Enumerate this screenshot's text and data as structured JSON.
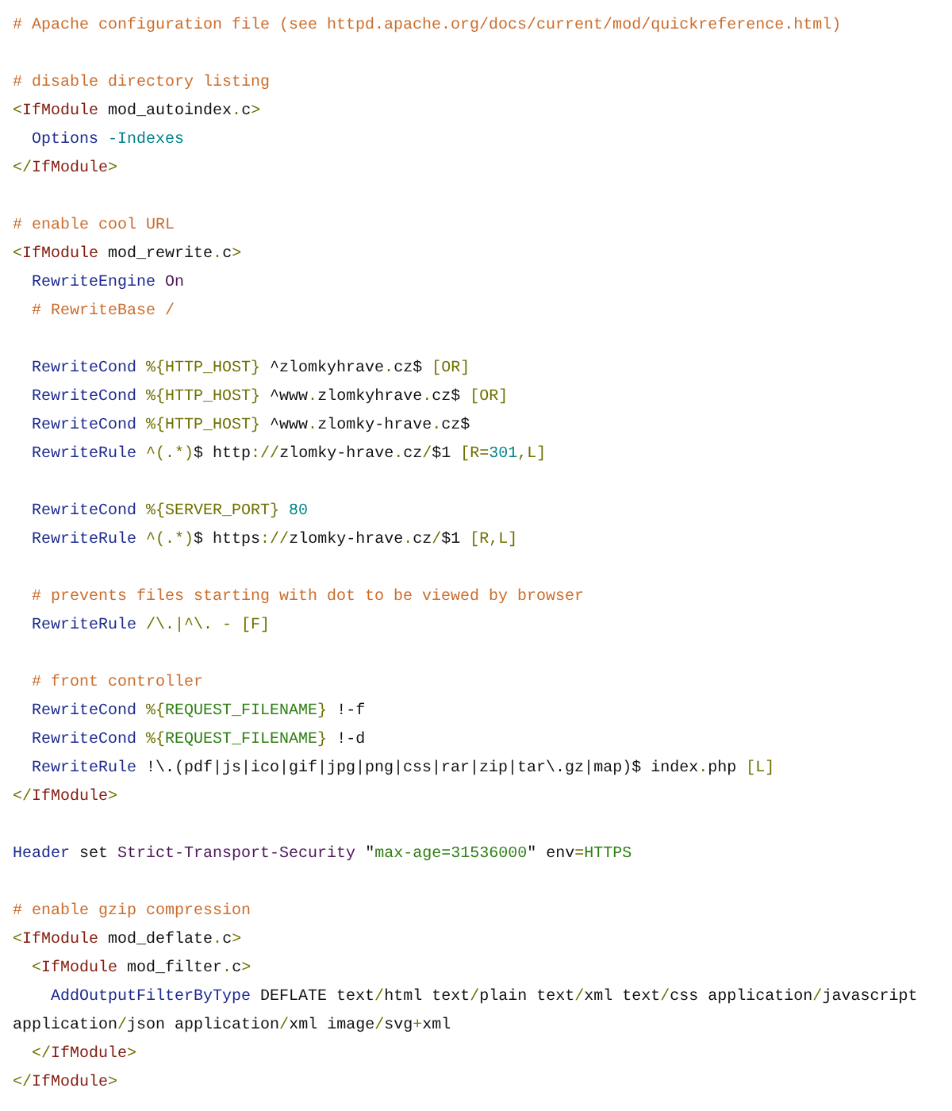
{
  "code_lines": [
    {
      "kind": "code",
      "tokens": [
        {
          "text": "# Apache configuration file (see httpd.apache.org/docs/current/mod/quickreference.html)",
          "kind": "comment"
        }
      ]
    },
    {
      "kind": "blank"
    },
    {
      "kind": "code",
      "tokens": [
        {
          "text": "# disable directory listing",
          "kind": "comment"
        }
      ]
    },
    {
      "kind": "code",
      "tokens": [
        {
          "text": "<",
          "kind": "punct"
        },
        {
          "text": "IfModule",
          "kind": "tag"
        },
        {
          "text": " mod_autoindex",
          "kind": "plain"
        },
        {
          "text": ".",
          "kind": "punct"
        },
        {
          "text": "c",
          "kind": "plain"
        },
        {
          "text": ">",
          "kind": "punct"
        }
      ]
    },
    {
      "kind": "code",
      "tokens": [
        {
          "text": "  Options",
          "kind": "directive"
        },
        {
          "text": " -Indexes",
          "kind": "number"
        }
      ]
    },
    {
      "kind": "code",
      "tokens": [
        {
          "text": "</",
          "kind": "punct"
        },
        {
          "text": "IfModule",
          "kind": "tag"
        },
        {
          "text": ">",
          "kind": "punct"
        }
      ]
    },
    {
      "kind": "blank"
    },
    {
      "kind": "code",
      "tokens": [
        {
          "text": "# enable cool URL",
          "kind": "comment"
        }
      ]
    },
    {
      "kind": "code",
      "tokens": [
        {
          "text": "<",
          "kind": "punct"
        },
        {
          "text": "IfModule",
          "kind": "tag"
        },
        {
          "text": " mod_rewrite",
          "kind": "plain"
        },
        {
          "text": ".",
          "kind": "punct"
        },
        {
          "text": "c",
          "kind": "plain"
        },
        {
          "text": ">",
          "kind": "punct"
        }
      ]
    },
    {
      "kind": "code",
      "tokens": [
        {
          "text": "  RewriteEngine",
          "kind": "directive"
        },
        {
          "text": " On",
          "kind": "keyword"
        }
      ]
    },
    {
      "kind": "code",
      "tokens": [
        {
          "text": "  # RewriteBase /",
          "kind": "comment"
        }
      ]
    },
    {
      "kind": "blank"
    },
    {
      "kind": "code",
      "tokens": [
        {
          "text": "  RewriteCond",
          "kind": "directive"
        },
        {
          "text": " %{HTTP_HOST}",
          "kind": "punct"
        },
        {
          "text": " ^zlomkyhrave",
          "kind": "plain"
        },
        {
          "text": ".",
          "kind": "punct"
        },
        {
          "text": "cz$ ",
          "kind": "plain"
        },
        {
          "text": "[OR]",
          "kind": "punct"
        }
      ]
    },
    {
      "kind": "code",
      "tokens": [
        {
          "text": "  RewriteCond",
          "kind": "directive"
        },
        {
          "text": " %{HTTP_HOST}",
          "kind": "punct"
        },
        {
          "text": " ^www",
          "kind": "plain"
        },
        {
          "text": ".",
          "kind": "punct"
        },
        {
          "text": "zlomkyhrave",
          "kind": "plain"
        },
        {
          "text": ".",
          "kind": "punct"
        },
        {
          "text": "cz$ ",
          "kind": "plain"
        },
        {
          "text": "[OR]",
          "kind": "punct"
        }
      ]
    },
    {
      "kind": "code",
      "tokens": [
        {
          "text": "  RewriteCond",
          "kind": "directive"
        },
        {
          "text": " %{HTTP_HOST}",
          "kind": "punct"
        },
        {
          "text": " ^www",
          "kind": "plain"
        },
        {
          "text": ".",
          "kind": "punct"
        },
        {
          "text": "zlomky-hrave",
          "kind": "plain"
        },
        {
          "text": ".",
          "kind": "punct"
        },
        {
          "text": "cz$",
          "kind": "plain"
        }
      ]
    },
    {
      "kind": "code",
      "tokens": [
        {
          "text": "  RewriteRule",
          "kind": "directive"
        },
        {
          "text": " ^(.*)",
          "kind": "punct"
        },
        {
          "text": "$ http",
          "kind": "plain"
        },
        {
          "text": "://",
          "kind": "punct"
        },
        {
          "text": "zlomky-hrave",
          "kind": "plain"
        },
        {
          "text": ".",
          "kind": "punct"
        },
        {
          "text": "cz",
          "kind": "plain"
        },
        {
          "text": "/",
          "kind": "punct"
        },
        {
          "text": "$1 ",
          "kind": "plain"
        },
        {
          "text": "[R=",
          "kind": "punct"
        },
        {
          "text": "301",
          "kind": "number"
        },
        {
          "text": ",L]",
          "kind": "punct"
        }
      ]
    },
    {
      "kind": "blank"
    },
    {
      "kind": "code",
      "tokens": [
        {
          "text": "  RewriteCond",
          "kind": "directive"
        },
        {
          "text": " %{SERVER_PORT}",
          "kind": "punct"
        },
        {
          "text": " 80",
          "kind": "number"
        }
      ]
    },
    {
      "kind": "code",
      "tokens": [
        {
          "text": "  RewriteRule",
          "kind": "directive"
        },
        {
          "text": " ^(.*)",
          "kind": "punct"
        },
        {
          "text": "$ https",
          "kind": "plain"
        },
        {
          "text": "://",
          "kind": "punct"
        },
        {
          "text": "zlomky-hrave",
          "kind": "plain"
        },
        {
          "text": ".",
          "kind": "punct"
        },
        {
          "text": "cz",
          "kind": "plain"
        },
        {
          "text": "/",
          "kind": "punct"
        },
        {
          "text": "$1 ",
          "kind": "plain"
        },
        {
          "text": "[R,L]",
          "kind": "punct"
        }
      ]
    },
    {
      "kind": "blank"
    },
    {
      "kind": "code",
      "tokens": [
        {
          "text": "  # prevents files starting with dot to be viewed by browser",
          "kind": "comment"
        }
      ]
    },
    {
      "kind": "code",
      "tokens": [
        {
          "text": "  RewriteRule",
          "kind": "directive"
        },
        {
          "text": " /\\.|^\\. - [F]",
          "kind": "punct"
        }
      ]
    },
    {
      "kind": "blank"
    },
    {
      "kind": "code",
      "tokens": [
        {
          "text": "  # front controller",
          "kind": "comment"
        }
      ]
    },
    {
      "kind": "code",
      "tokens": [
        {
          "text": "  RewriteCond",
          "kind": "directive"
        },
        {
          "text": " %{",
          "kind": "punct"
        },
        {
          "text": "REQUEST_FILENAME",
          "kind": "string"
        },
        {
          "text": "}",
          "kind": "punct"
        },
        {
          "text": " !-f",
          "kind": "plain"
        }
      ]
    },
    {
      "kind": "code",
      "tokens": [
        {
          "text": "  RewriteCond",
          "kind": "directive"
        },
        {
          "text": " %{",
          "kind": "punct"
        },
        {
          "text": "REQUEST_FILENAME",
          "kind": "string"
        },
        {
          "text": "}",
          "kind": "punct"
        },
        {
          "text": " !-d",
          "kind": "plain"
        }
      ]
    },
    {
      "kind": "code",
      "tokens": [
        {
          "text": "  RewriteRule",
          "kind": "directive"
        },
        {
          "text": " !\\.(pdf|js|ico|gif|jpg|png|css|rar|zip|tar\\.gz|map)$ index",
          "kind": "plain"
        },
        {
          "text": ".",
          "kind": "punct"
        },
        {
          "text": "php ",
          "kind": "plain"
        },
        {
          "text": "[L]",
          "kind": "punct"
        }
      ]
    },
    {
      "kind": "code",
      "tokens": [
        {
          "text": "</",
          "kind": "punct"
        },
        {
          "text": "IfModule",
          "kind": "tag"
        },
        {
          "text": ">",
          "kind": "punct"
        }
      ]
    },
    {
      "kind": "blank"
    },
    {
      "kind": "code",
      "tokens": [
        {
          "text": "Header",
          "kind": "directive"
        },
        {
          "text": " set ",
          "kind": "plain"
        },
        {
          "text": "Strict-Transport-Security",
          "kind": "keyword"
        },
        {
          "text": " \"",
          "kind": "plain"
        },
        {
          "text": "max-age=31536000",
          "kind": "string"
        },
        {
          "text": "\" env",
          "kind": "plain"
        },
        {
          "text": "=",
          "kind": "punct"
        },
        {
          "text": "HTTPS",
          "kind": "string"
        }
      ]
    },
    {
      "kind": "blank"
    },
    {
      "kind": "code",
      "tokens": [
        {
          "text": "# enable gzip compression",
          "kind": "comment"
        }
      ]
    },
    {
      "kind": "code",
      "tokens": [
        {
          "text": "<",
          "kind": "punct"
        },
        {
          "text": "IfModule",
          "kind": "tag"
        },
        {
          "text": " mod_deflate",
          "kind": "plain"
        },
        {
          "text": ".",
          "kind": "punct"
        },
        {
          "text": "c",
          "kind": "plain"
        },
        {
          "text": ">",
          "kind": "punct"
        }
      ]
    },
    {
      "kind": "code",
      "tokens": [
        {
          "text": "  <",
          "kind": "punct"
        },
        {
          "text": "IfModule",
          "kind": "tag"
        },
        {
          "text": " mod_filter",
          "kind": "plain"
        },
        {
          "text": ".",
          "kind": "punct"
        },
        {
          "text": "c",
          "kind": "plain"
        },
        {
          "text": ">",
          "kind": "punct"
        }
      ]
    },
    {
      "kind": "code",
      "tokens": [
        {
          "text": "    AddOutputFilterByType",
          "kind": "directive"
        },
        {
          "text": " DEFLATE text",
          "kind": "plain"
        },
        {
          "text": "/",
          "kind": "punct"
        },
        {
          "text": "html text",
          "kind": "plain"
        },
        {
          "text": "/",
          "kind": "punct"
        },
        {
          "text": "plain text",
          "kind": "plain"
        },
        {
          "text": "/",
          "kind": "punct"
        },
        {
          "text": "xml text",
          "kind": "plain"
        },
        {
          "text": "/",
          "kind": "punct"
        },
        {
          "text": "css application",
          "kind": "plain"
        },
        {
          "text": "/",
          "kind": "punct"
        },
        {
          "text": "javascript",
          "kind": "plain"
        }
      ]
    },
    {
      "kind": "code",
      "tokens": [
        {
          "text": "application",
          "kind": "plain"
        },
        {
          "text": "/",
          "kind": "punct"
        },
        {
          "text": "json application",
          "kind": "plain"
        },
        {
          "text": "/",
          "kind": "punct"
        },
        {
          "text": "xml image",
          "kind": "plain"
        },
        {
          "text": "/",
          "kind": "punct"
        },
        {
          "text": "svg",
          "kind": "plain"
        },
        {
          "text": "+",
          "kind": "punct"
        },
        {
          "text": "xml",
          "kind": "plain"
        }
      ]
    },
    {
      "kind": "code",
      "tokens": [
        {
          "text": "  </",
          "kind": "punct"
        },
        {
          "text": "IfModule",
          "kind": "tag"
        },
        {
          "text": ">",
          "kind": "punct"
        }
      ]
    },
    {
      "kind": "code",
      "tokens": [
        {
          "text": "</",
          "kind": "punct"
        },
        {
          "text": "IfModule",
          "kind": "tag"
        },
        {
          "text": ">",
          "kind": "punct"
        }
      ]
    }
  ]
}
